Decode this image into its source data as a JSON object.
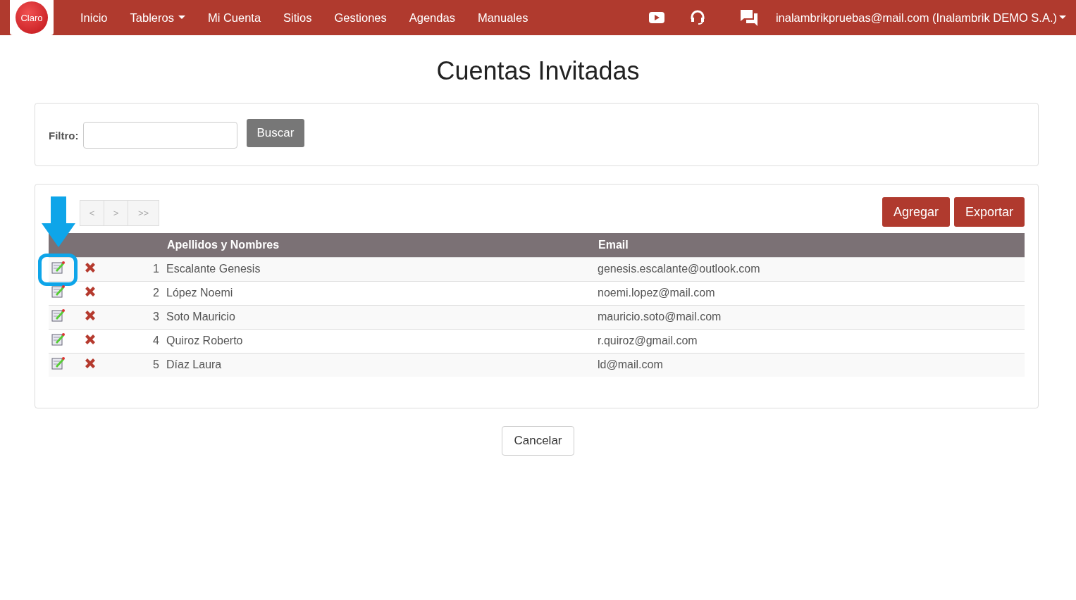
{
  "nav": {
    "items": [
      {
        "label": "Inicio",
        "dropdown": false
      },
      {
        "label": "Tableros",
        "dropdown": true
      },
      {
        "label": "Mi Cuenta",
        "dropdown": false
      },
      {
        "label": "Sitios",
        "dropdown": false
      },
      {
        "label": "Gestiones",
        "dropdown": false
      },
      {
        "label": "Agendas",
        "dropdown": false
      },
      {
        "label": "Manuales",
        "dropdown": false
      }
    ],
    "user": "inalambrikpruebas@mail.com (Inalambrik DEMO S.A.)"
  },
  "logo": "Claro",
  "title": "Cuentas Invitadas",
  "filter": {
    "label": "Filtro:",
    "button": "Buscar"
  },
  "pager": [
    "<",
    ">",
    ">>"
  ],
  "actions": [
    "Agregar",
    "Exportar"
  ],
  "table": {
    "columns": [
      "Apellidos y Nombres",
      "Email"
    ],
    "rows": [
      {
        "index": "1",
        "name": "Escalante Genesis",
        "email": "genesis.escalante@outlook.com",
        "highlighted": true
      },
      {
        "index": "2",
        "name": "López Noemi",
        "email": "noemi.lopez@mail.com",
        "highlighted": false
      },
      {
        "index": "3",
        "name": "Soto Mauricio",
        "email": "mauricio.soto@mail.com",
        "highlighted": false
      },
      {
        "index": "4",
        "name": "Quiroz Roberto",
        "email": "r.quiroz@gmail.com",
        "highlighted": false
      },
      {
        "index": "5",
        "name": "Díaz Laura",
        "email": "ld@mail.com",
        "highlighted": false
      }
    ]
  },
  "cancel": "Cancelar"
}
